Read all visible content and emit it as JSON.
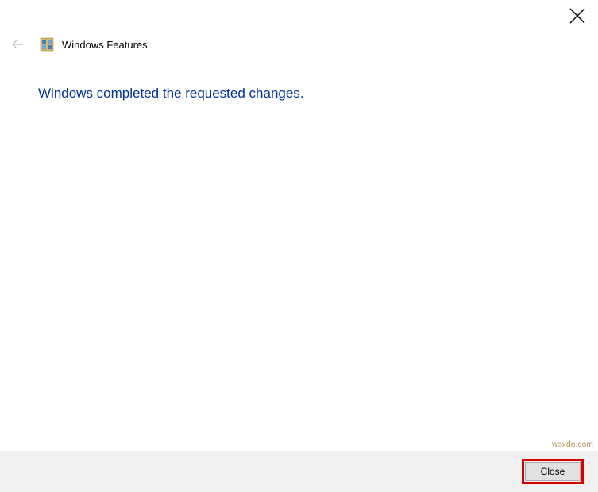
{
  "window": {
    "title": "Windows Features"
  },
  "main": {
    "message": "Windows completed the requested changes."
  },
  "footer": {
    "close_label": "Close"
  },
  "watermark": "wsxdn.com"
}
